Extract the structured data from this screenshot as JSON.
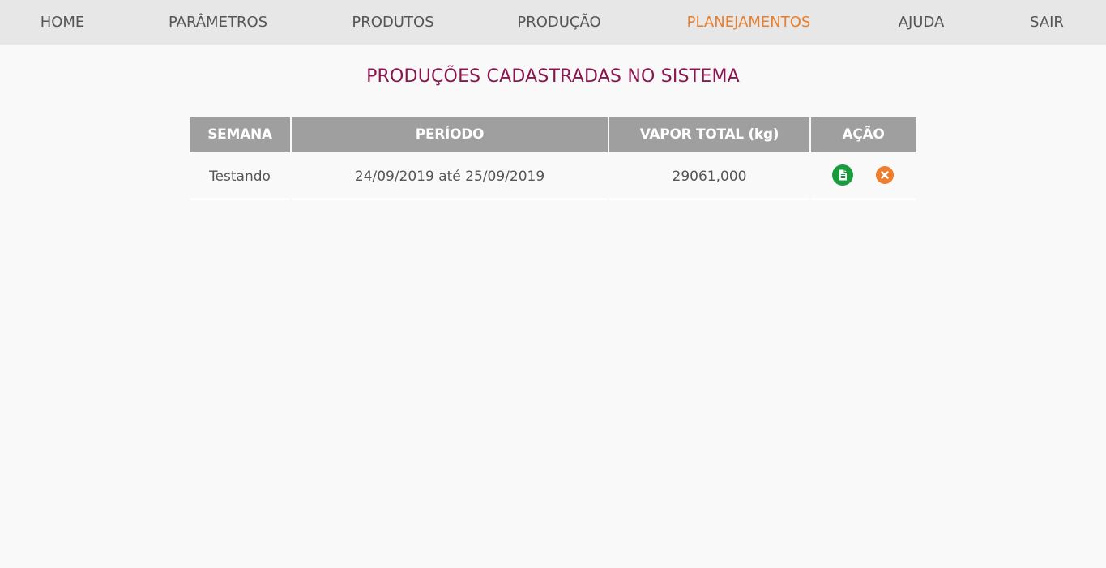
{
  "nav": {
    "items": [
      {
        "label": "HOME"
      },
      {
        "label": "PARÂMETROS"
      },
      {
        "label": "PRODUTOS"
      },
      {
        "label": "PRODUÇÃO"
      },
      {
        "label": "PLANEJAMENTOS",
        "active": true
      },
      {
        "label": "AJUDA"
      },
      {
        "label": "SAIR"
      }
    ],
    "active_color": "#e87f2e"
  },
  "page": {
    "title": "PRODUÇÕES CADASTRADAS NO SISTEMA",
    "title_color": "#8a1650"
  },
  "table": {
    "headers": [
      "SEMANA",
      "PERÍODO",
      "VAPOR TOTAL (kg)",
      "AÇÃO"
    ],
    "rows": [
      {
        "semana": "Testando",
        "periodo": "24/09/2019 até 25/09/2019",
        "vapor_total": "29061,000",
        "actions": [
          {
            "icon": "document-icon",
            "color": "#1a9c3e"
          },
          {
            "icon": "close-circle-icon",
            "color": "#ef7d2b"
          }
        ]
      }
    ]
  }
}
